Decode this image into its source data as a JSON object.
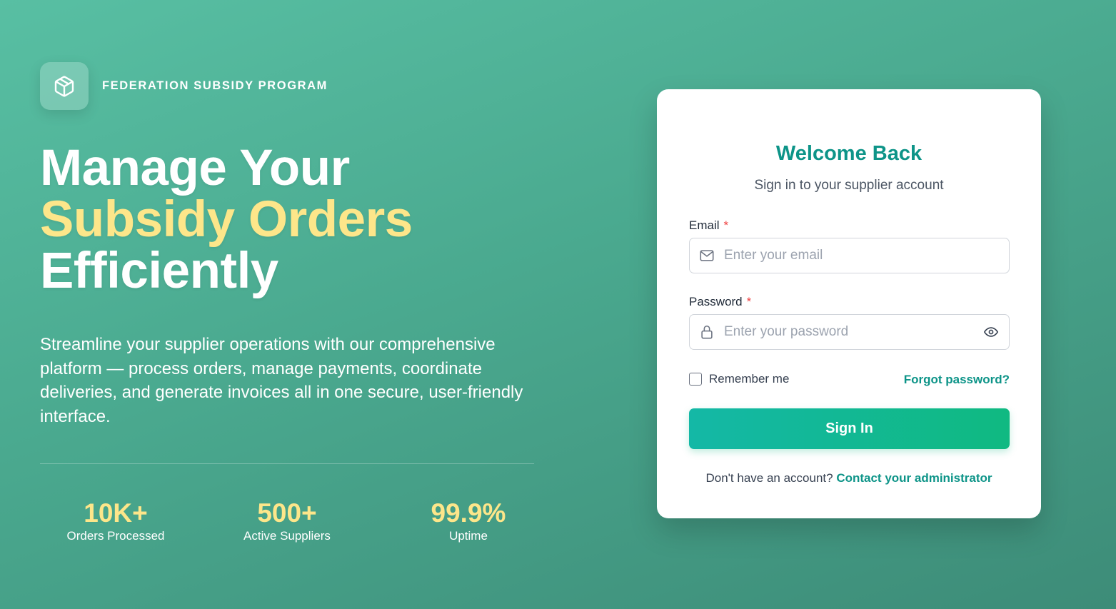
{
  "brand": {
    "name": "FEDERATION SUBSIDY PROGRAM",
    "logo_icon": "package-box-icon"
  },
  "hero": {
    "headline_line1": "Manage Your",
    "headline_line2": "Subsidy Orders",
    "headline_line3": "Efficiently",
    "lead": "Streamline your supplier operations with our comprehensive platform — process orders, manage payments, coordinate deliveries, and generate invoices all in one secure, user-friendly interface."
  },
  "stats": [
    {
      "value": "10K+",
      "label": "Orders Processed"
    },
    {
      "value": "500+",
      "label": "Active Suppliers"
    },
    {
      "value": "99.9%",
      "label": "Uptime"
    }
  ],
  "login": {
    "title": "Welcome Back",
    "subtitle": "Sign in to your supplier account",
    "email_label": "Email",
    "email_placeholder": "Enter your email",
    "email_value": "",
    "password_label": "Password",
    "password_placeholder": "Enter your password",
    "password_value": "",
    "required_mark": "*",
    "remember_label": "Remember me",
    "remember_checked": false,
    "forgot_label": "Forgot password?",
    "signin_label": "Sign In",
    "footer_text": "Don't have an account?",
    "footer_link": "Contact your administrator"
  },
  "colors": {
    "accent": "#0d9488",
    "highlight": "#fde68a",
    "button_start": "#14b8a6",
    "button_end": "#10b981",
    "required": "#ef4444"
  }
}
